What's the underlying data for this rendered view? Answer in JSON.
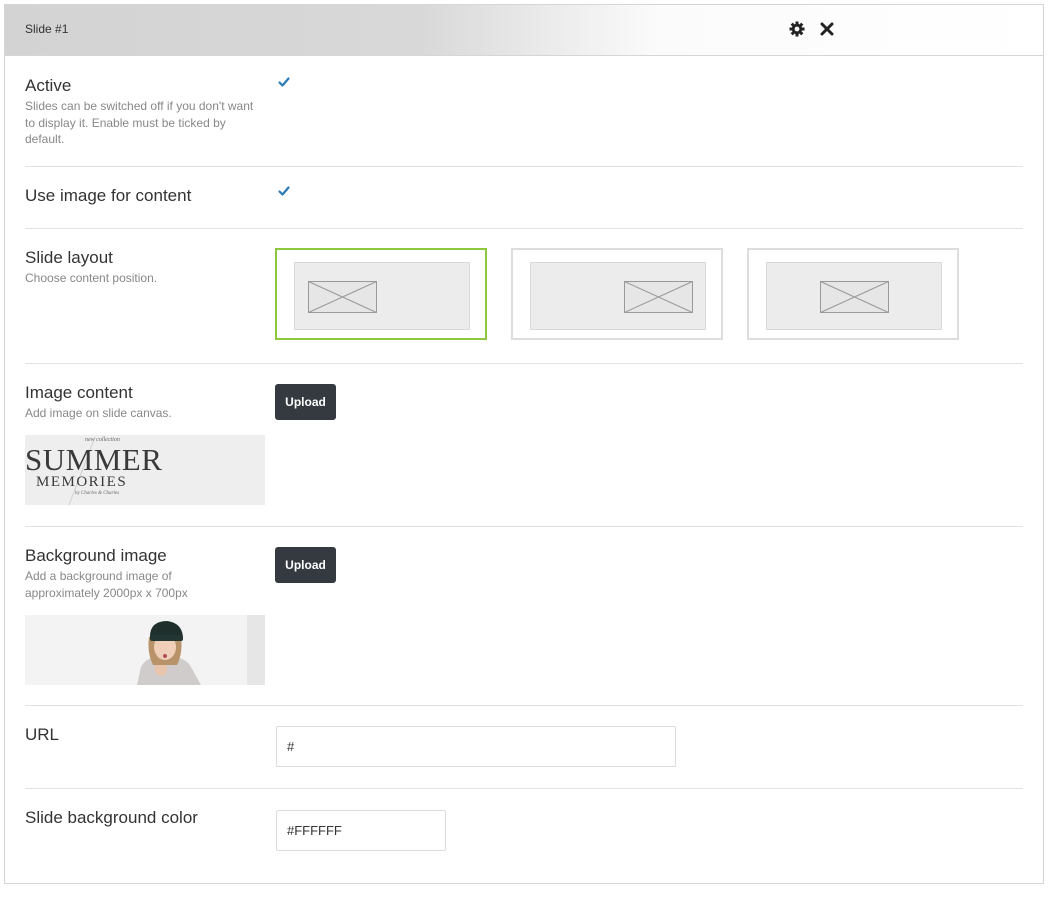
{
  "header": {
    "title": "Slide #1",
    "settings_icon": "gear-icon",
    "close_icon": "close-icon"
  },
  "fields": {
    "active": {
      "label": "Active",
      "description": "Slides can be switched off if you don't want to display it. Enable must be ticked by default.",
      "checked": true
    },
    "use_image": {
      "label": "Use image for content",
      "checked": true
    },
    "slide_layout": {
      "label": "Slide layout",
      "description": "Choose content position.",
      "options": [
        "left",
        "right",
        "center"
      ],
      "selected": "left"
    },
    "image_content": {
      "label": "Image content",
      "description": "Add image on slide canvas.",
      "button_label": "Upload",
      "preview": {
        "line_small": "new collection",
        "line_big": "SUMMER",
        "line_mid": "MEMORIES",
        "line_credit": "by Charles & Charles"
      }
    },
    "background_image": {
      "label": "Background image",
      "description": "Add a background image of approximately 2000px x 700px",
      "button_label": "Upload"
    },
    "url": {
      "label": "URL",
      "value": "#"
    },
    "bg_color": {
      "label": "Slide background color",
      "value": "#FFFFFF"
    }
  },
  "colors": {
    "accent_selected": "#8dc63f",
    "checkbox_tick": "#2a7ab8",
    "button_bg": "#353a40"
  }
}
